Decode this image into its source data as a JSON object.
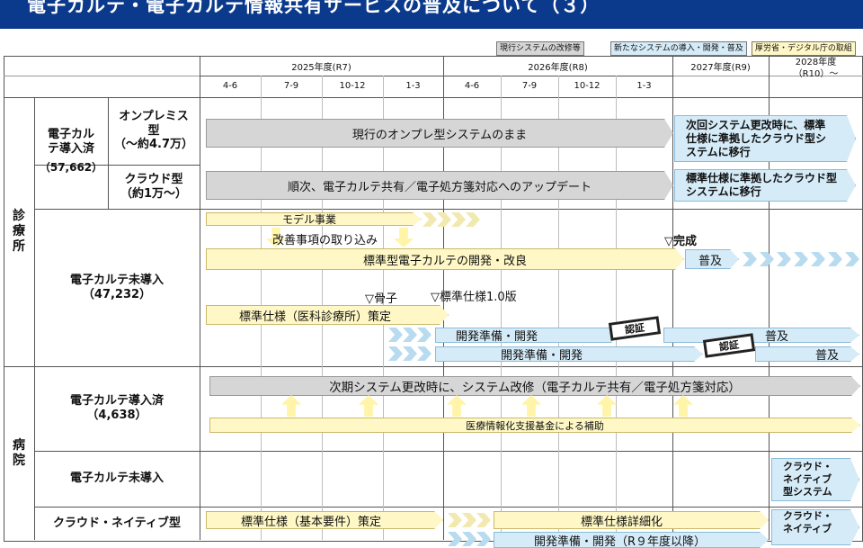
{
  "title": "電子カルテ・電子カルテ情報共有サービスの普及について（３）",
  "legend": {
    "gray": "現行システムの改修等",
    "blue": "新たなシステムの導入・開発・普及",
    "yellow": "厚労省・デジタル庁の取組"
  },
  "colors": {
    "header_bar": "#0b3a8c",
    "gray": "#d6d6d6",
    "blue": "#d5ebf8",
    "yellow": "#fff8c6"
  },
  "years": [
    "2025年度(R7)",
    "2026年度(R8)",
    "2027年度(R9)",
    "2028年度\n（R10）～"
  ],
  "quarters_2025": [
    "4-6",
    "7-9",
    "10-12",
    "1-3"
  ],
  "quarters_2026": [
    "4-6",
    "7-9",
    "10-12",
    "1-3"
  ],
  "sections": {
    "clinic": "診\n療\n所",
    "hospital": "病\n院"
  },
  "rows": {
    "clinic_ehr_installed": "電子カル\nテ導入済",
    "clinic_ehr_installed_count": "（57,662）",
    "onpremise": "オンプレミス\n型\n（～約4.7万）",
    "cloud": "クラウド型\n（約1万～）",
    "clinic_not_installed": "電子カルテ未導入\n（47,232）",
    "hospital_installed": "電子カルテ導入済\n（4,638）",
    "hospital_not_installed": "電子カルテ未導入",
    "cloud_native": "クラウド・ネイティブ型"
  },
  "bars": {
    "onprem_current": "現行のオンプレ型システムのまま",
    "onprem_next": "次回システム更改時に、標準\n仕様に準拠したクラウド型シ\nステムに移行",
    "cloud_update": "順次、電子カルテ共有／電子処方箋対応へのアップデート",
    "cloud_next": "標準仕様に準拠したクラウド型\nシステムに移行",
    "model_project": "モデル事業",
    "improvements": "改善事項の取り込み",
    "completion": "▽完成",
    "std_ehr_dev": "標準型電子カルテの開発・改良",
    "spread": "普及",
    "bone": "▽骨子",
    "std_spec_1": "▽標準仕様1.0版",
    "std_spec_clinic": "標準仕様（医科診療所）策定",
    "dev_prep_1": "開発準備・開発",
    "cert": "認証",
    "spread_2": "普及",
    "dev_prep_2": "開発準備・開発",
    "cert_2": "認証",
    "spread_3": "普及",
    "hospital_update": "次期システム更改時に、システム改修（電子カルテ共有／電子処方箋対応）",
    "subsidy": "医療情報化支援基金による補助",
    "cloud_native_sys": "クラウド・\nネイティブ\n型システム",
    "std_spec_basic": "標準仕様（基本要件）策定",
    "std_spec_detail": "標準仕様詳細化",
    "dev_prep_3": "開発準備・開発（R９年度以降）",
    "cloud_native_2": "クラウド・\nネイティブ"
  }
}
